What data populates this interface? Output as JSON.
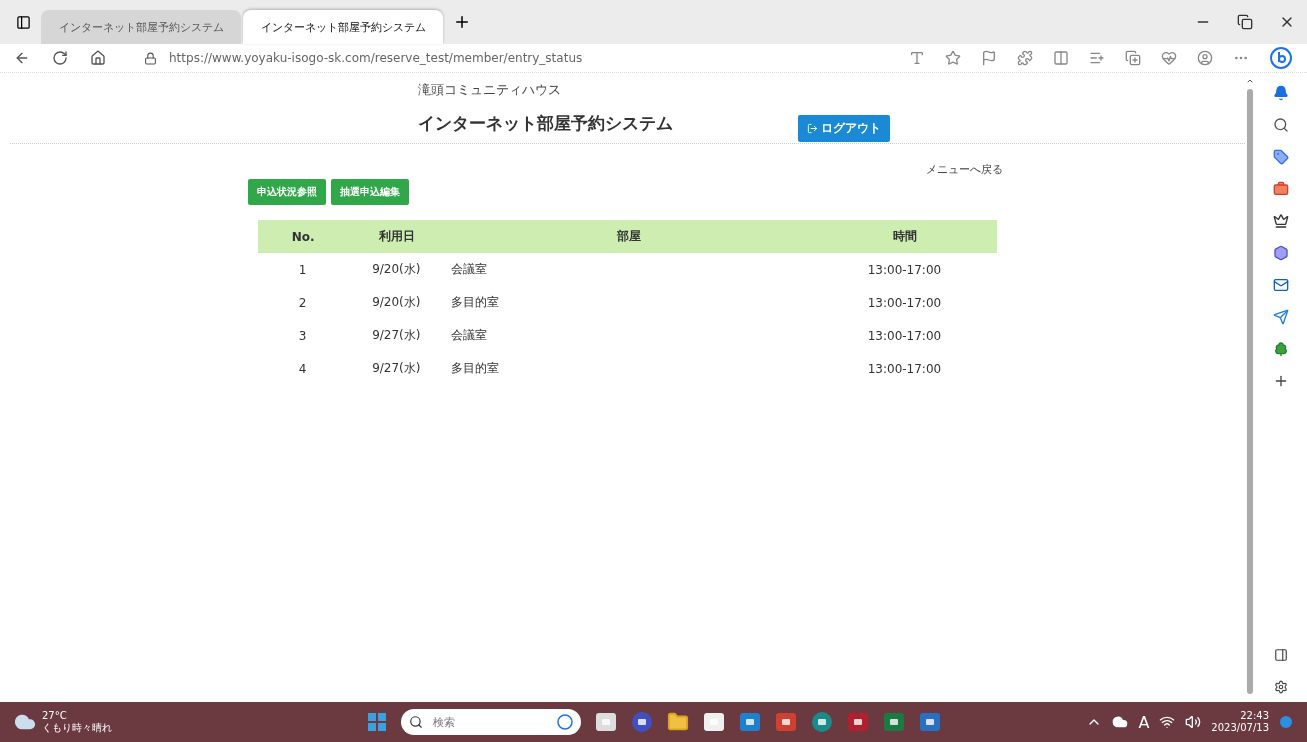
{
  "browser": {
    "tabs": [
      {
        "title": "インターネット部屋予約システム",
        "selected": false
      },
      {
        "title": "インターネット部屋予約システム",
        "selected": true
      }
    ],
    "url": "https://www.yoyaku-isogo-sk.com/reserve_test/member/entry_status"
  },
  "page": {
    "facility": "滝頭コミュニティハウス",
    "title": "インターネット部屋予約システム",
    "logout": "ログアウト",
    "back_link": "メニューへ戻る",
    "actions": [
      {
        "label": "申込状況参照"
      },
      {
        "label": "抽選申込編集"
      }
    ],
    "table": {
      "columns": [
        "No.",
        "利用日",
        "部屋",
        "時間"
      ],
      "rows": [
        [
          "1",
          "9/20(水)",
          "会議室",
          "13:00-17:00"
        ],
        [
          "2",
          "9/20(水)",
          "多目的室",
          "13:00-17:00"
        ],
        [
          "3",
          "9/27(水)",
          "会議室",
          "13:00-17:00"
        ],
        [
          "4",
          "9/27(水)",
          "多目的室",
          "13:00-17:00"
        ]
      ]
    }
  },
  "taskbar": {
    "weather": {
      "temperature": "27°C",
      "condition": "くもり時々晴れ"
    },
    "search": {
      "placeholder": "検索"
    },
    "ime": "A",
    "time": "22:43",
    "date": "2023/07/13"
  }
}
